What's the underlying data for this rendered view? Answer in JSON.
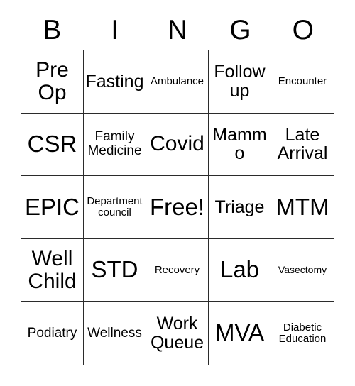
{
  "card": {
    "title": "BINGO",
    "free_space_label": "Free!",
    "colors": {
      "background": "#ffffff",
      "text": "#000000",
      "grid_border": "#1a1a1a",
      "cell_border": "#2b2b2b"
    }
  },
  "header": {
    "letters": [
      {
        "label": "B"
      },
      {
        "label": "I"
      },
      {
        "label": "N"
      },
      {
        "label": "G"
      },
      {
        "label": "O"
      }
    ]
  },
  "grid": {
    "columns": 5,
    "rows": 5,
    "cells": [
      {
        "text": "Pre Op",
        "size": "t-lg",
        "free": false
      },
      {
        "text": "Fasting",
        "size": "t-md",
        "free": false
      },
      {
        "text": "Ambulance",
        "size": "t-xs",
        "free": false
      },
      {
        "text": "Follow up",
        "size": "t-md",
        "free": false
      },
      {
        "text": "Encounter",
        "size": "t-xs",
        "free": false
      },
      {
        "text": "CSR",
        "size": "t-xl",
        "free": false
      },
      {
        "text": "Family Medicine",
        "size": "t-sm",
        "free": false
      },
      {
        "text": "Covid",
        "size": "t-lg",
        "free": false
      },
      {
        "text": "Mammo",
        "size": "t-md",
        "free": false
      },
      {
        "text": "Late Arrival",
        "size": "t-md",
        "free": false
      },
      {
        "text": "EPIC",
        "size": "t-xl",
        "free": false
      },
      {
        "text": "Department council",
        "size": "t-xs",
        "free": false
      },
      {
        "text": "Free!",
        "size": "t-xl",
        "free": true
      },
      {
        "text": "Triage",
        "size": "t-md",
        "free": false
      },
      {
        "text": "MTM",
        "size": "t-xl",
        "free": false
      },
      {
        "text": "Well Child",
        "size": "t-lg",
        "free": false
      },
      {
        "text": "STD",
        "size": "t-xl",
        "free": false
      },
      {
        "text": "Recovery",
        "size": "t-xs",
        "free": false
      },
      {
        "text": "Lab",
        "size": "t-xl",
        "free": false
      },
      {
        "text": "Vasectomy",
        "size": "t-xxs",
        "free": false
      },
      {
        "text": "Podiatry",
        "size": "t-sm",
        "free": false
      },
      {
        "text": "Wellness",
        "size": "t-sm",
        "free": false
      },
      {
        "text": "Work Queue",
        "size": "t-md",
        "free": false
      },
      {
        "text": "MVA",
        "size": "t-xl",
        "free": false
      },
      {
        "text": "Diabetic Education",
        "size": "t-xs",
        "free": false
      }
    ]
  }
}
